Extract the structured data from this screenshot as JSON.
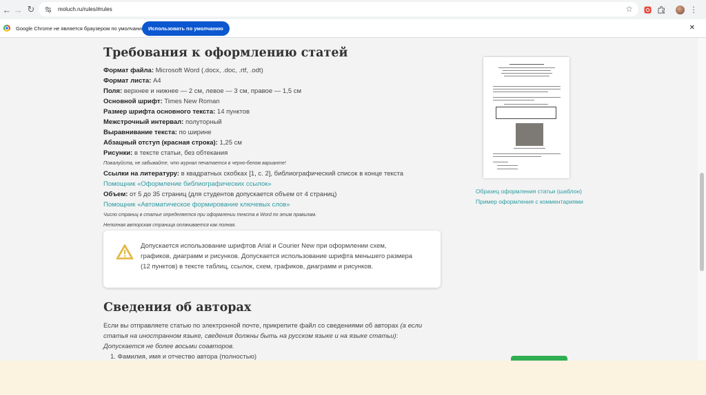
{
  "browser": {
    "url": "moluch.ru/rules/#rules",
    "nav": {
      "back": "←",
      "forward": "→",
      "reload": "↻",
      "star": "☆",
      "menu": "⋮"
    },
    "icons": [
      "back-icon",
      "forward-icon",
      "reload-icon",
      "site-settings-icon",
      "star-icon",
      "extension-icon",
      "puzzle-icon",
      "profile-avatar",
      "menu-icon"
    ]
  },
  "infobar": {
    "message": "Google Chrome не является браузером по умолчанию.",
    "button": "Использовать по умолчанию",
    "close": "✕"
  },
  "rules": {
    "title": "Требования к оформлению статей",
    "items": [
      {
        "label": "Формат файла:",
        "value": " Microsoft Word (.docx, .doc, .rtf, .odt)"
      },
      {
        "label": "Формат листа:",
        "value": " А4"
      },
      {
        "label": "Поля:",
        "value": " верхнее и нижнее — 2 см, левое — 3 см, правое — 1,5 см"
      },
      {
        "label": "Основной шрифт:",
        "value": " Times New Roman"
      },
      {
        "label": "Размер шрифта основного текста:",
        "value": " 14 пунктов"
      },
      {
        "label": "Межстрочный интервал:",
        "value": " полуторный"
      },
      {
        "label": "Выравнивание текста:",
        "value": " по ширине"
      },
      {
        "label": "Абзацный отступ (красная строка):",
        "value": " 1,25 см"
      },
      {
        "label": "Рисунки:",
        "value": " в тексте статьи, без обтекания"
      }
    ],
    "bw_note": "Пожалуйста, не забывайте, что журнал печатается в черно-белом варианте!",
    "refs_label": "Ссылки на литературу:",
    "refs_value": " в квадратных скобках [1, с. 2], библиографический список в конце текста",
    "biblio_link": "Помощник «Оформление библиографических ссылок»",
    "volume_label": "Объем:",
    "volume_value": " от 5 до 35 страниц (для студентов допускается объем от 4 страниц)",
    "keywords_link": "Помощник «Автоматическое формирование ключевых слов»",
    "pages_note": "Число страниц в статье определяется при оформлении текста в Word по этим правилам.",
    "partial_note": "Неполная авторская страница оплачивается как полная."
  },
  "notice": {
    "text": "Допускается использование шрифтов Arial и Courier New при оформлении схем, графиков, диаграмм и рисунков. Допускается использование шрифта меньшего размера (12 пунктов) в тексте таблиц, ссылок, схем, графиков, диаграмм и рисунков."
  },
  "authors": {
    "title": "Сведения об авторах",
    "intro": "Если вы отправляете статью по электронной почте, прикрепите файл со сведениями об авторах ",
    "intro_italic": "(а если статья на иностранном языке, сведения должны быть на русском языке и на языке статьи)",
    "intro_end": ":",
    "max_authors": "Допускается не более восьми соавторов.",
    "list_item_1": "1. Фамилия, имя и отчество автора (полностью)"
  },
  "sidebar": {
    "template_link": "Образец оформления статьи (шаблон)",
    "example_link": "Пример оформления с комментариями"
  },
  "colors": {
    "accent_link": "#2a9aa0",
    "chrome_button": "#0b57d0",
    "green_button": "#2fae52",
    "bottom_band": "#fbf2df"
  }
}
